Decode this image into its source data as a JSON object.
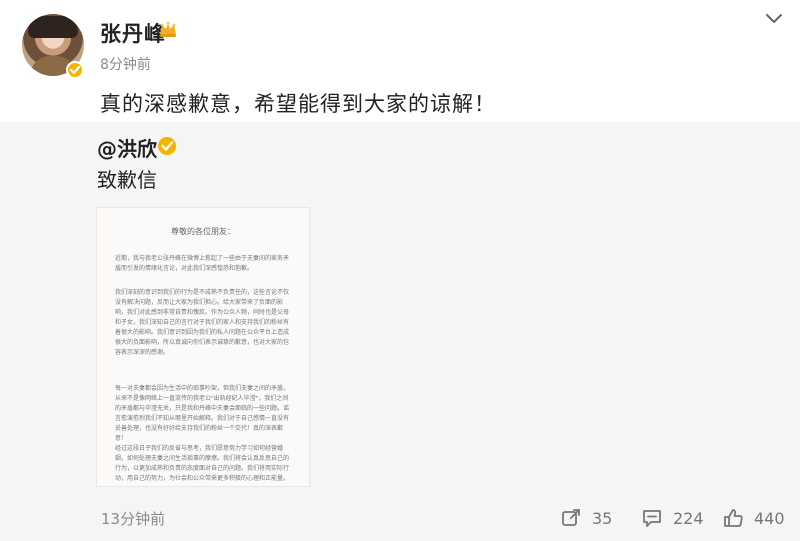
{
  "post": {
    "author": "张丹峰",
    "time": "8分钟前",
    "text": "真的深感歉意，希望能得到大家的谅解！"
  },
  "quoted": {
    "mention": "@洪欣",
    "text": "致歉信",
    "letter": {
      "title": "尊敬的各位朋友：",
      "paragraphs": [
        "近期，我与我老公张丹峰在微博上惹起了一些由于夫妻间的家务矛盾而引发的情绪化言论，对此我们深感惶恐和抱歉。",
        "我们深刻的意识到我们的行为是不成熟不负责任的，这些言论不仅没有解决问题，反而让大家为我们担心。给大家带来了负面的影响，我们对此感到非常自责和愧疚。作为公众人物，同时也是父母和子女，我们深知自己的言行对于我们的家人和支持我们的粉丝有着很大的影响。我们意识到因为我们的私人问题在公众平台上造成很大的负面影响，所以真诚向你们表示诚挚的歉意，也对大家的包容表示深深的感谢。",
        "每一对夫妻都会因为生活中的琐事吵架，但我们夫妻之间的矛盾，从来不是像网络上一直流传的我老公“出轨经纪人毕滢”，我们之间的矛盾都与毕滢无关，只是我和丹峰中夫妻会面临的一些问题。谣言愈演愈烈我们不知从哪里开始解释。我们对于自己感情一直没有妥善处理，也没有好好给支持我们的粉丝一个交代！真的深表歉意！",
        "经过这段日子我们的反省与思考，我们愿意努力学习如何经营婚姻，如何处理夫妻之间生活琐事的摩擦。我们将会认真反思自己的行为，以更加成熟和负责的态度面对自己的问题。我们将用实际行动，用自己的努力，为社会和公众带来更多积极的心理和正能量。"
      ]
    }
  },
  "footer": {
    "time": "13分钟前",
    "shares": "35",
    "comments": "224",
    "likes": "440"
  },
  "icons": {
    "verify": "verified-badge-icon",
    "crown": "crown-icon",
    "menu": "chevron-down-icon",
    "share": "share-icon",
    "comment": "comment-icon",
    "like": "like-icon"
  },
  "colors": {
    "verified": "#f6b400",
    "text": "#222222",
    "muted": "#8c8c8c",
    "quote_bg": "#f5f5f5"
  }
}
